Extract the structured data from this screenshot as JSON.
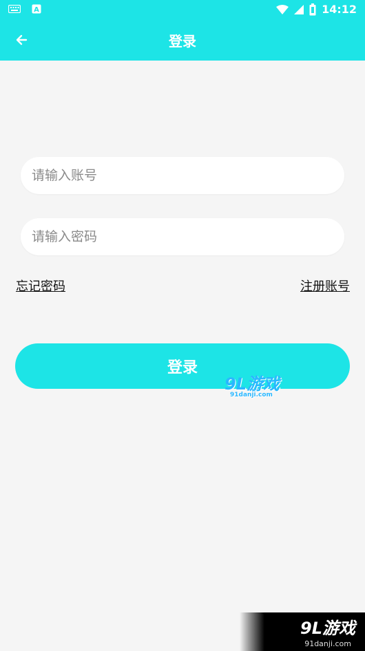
{
  "status_bar": {
    "time": "14:12",
    "left_icons": [
      "keyboard-icon",
      "a-notification-icon"
    ],
    "right_icons": [
      "wifi-icon",
      "signal-icon",
      "battery-icon"
    ]
  },
  "app_bar": {
    "title": "登录",
    "back_icon": "arrow-left-icon",
    "color": "#1de4e6"
  },
  "form": {
    "account_placeholder": "请输入账号",
    "password_placeholder": "请输入密码",
    "forgot_password": "忘记密码",
    "register_account": "注册账号",
    "login_button": "登录"
  },
  "watermark": {
    "brand": "9L游戏",
    "url": "91danji.com"
  }
}
